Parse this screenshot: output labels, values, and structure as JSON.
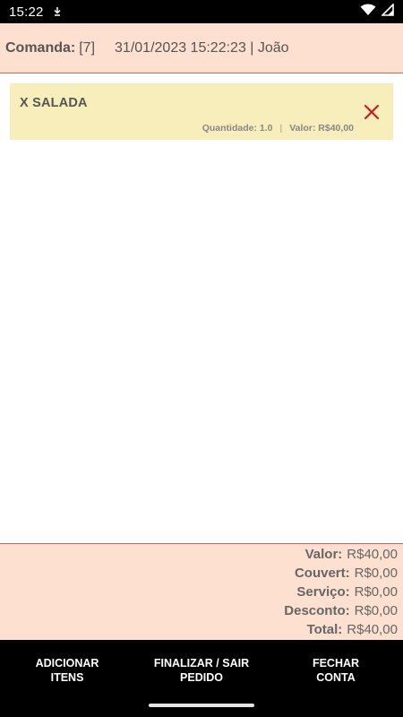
{
  "status_bar": {
    "time": "15:22",
    "icons": [
      "download-arrow-icon",
      "wifi-icon",
      "signal-icon"
    ]
  },
  "header": {
    "label": "Comanda:",
    "number": "[7]",
    "info": "31/01/2023 15:22:23 | João"
  },
  "items": [
    {
      "name": "X SALADA",
      "quantity": "Quantidade: 1.0",
      "separator": "|",
      "value": "Valor: R$40,00",
      "delete_icon": "close-icon"
    }
  ],
  "totals": {
    "rows": [
      {
        "label": "Valor:",
        "value": "R$40,00"
      },
      {
        "label": "Couvert:",
        "value": "R$0,00"
      },
      {
        "label": "Serviço:",
        "value": "R$0,00"
      },
      {
        "label": "Desconto:",
        "value": "R$0,00"
      },
      {
        "label": "Total:",
        "value": "R$40,00"
      }
    ]
  },
  "actions": {
    "add": {
      "line1": "ADICIONAR",
      "line2": "ITENS"
    },
    "finish": {
      "line1": "FINALIZAR / SAIR",
      "line2": "PEDIDO"
    },
    "close": {
      "line1": "FECHAR",
      "line2": "CONTA"
    }
  },
  "colors": {
    "header_bg": "#fde0cf",
    "accent_border": "#e0605a",
    "item_bg": "#f8eebc",
    "delete": "#cc1f1f",
    "bottom_bar": "#000000"
  }
}
